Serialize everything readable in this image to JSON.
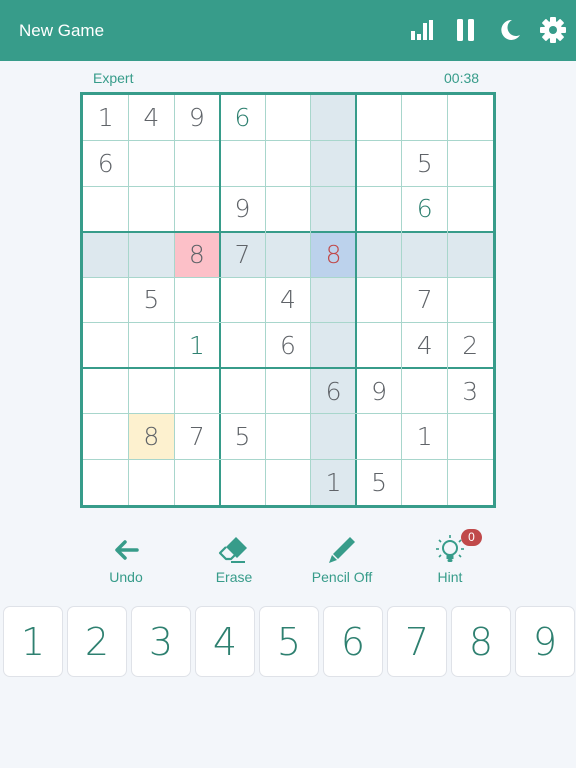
{
  "header": {
    "title": "New Game",
    "icons": [
      "stats-icon",
      "pause-icon",
      "dark-mode-icon",
      "settings-icon"
    ]
  },
  "game": {
    "difficulty": "Expert",
    "timer": "00:38",
    "selected_cell": {
      "row": 3,
      "col": 5
    },
    "grid": [
      [
        1,
        4,
        9,
        6,
        0,
        0,
        0,
        0,
        0
      ],
      [
        6,
        0,
        0,
        0,
        0,
        0,
        0,
        5,
        0
      ],
      [
        0,
        0,
        0,
        9,
        0,
        0,
        0,
        6,
        0
      ],
      [
        0,
        0,
        8,
        7,
        0,
        8,
        0,
        0,
        0
      ],
      [
        0,
        5,
        0,
        0,
        4,
        0,
        0,
        7,
        0
      ],
      [
        0,
        0,
        1,
        0,
        6,
        0,
        0,
        4,
        2
      ],
      [
        0,
        0,
        0,
        0,
        0,
        6,
        9,
        0,
        3
      ],
      [
        0,
        8,
        7,
        5,
        0,
        0,
        0,
        1,
        0
      ],
      [
        0,
        0,
        0,
        0,
        0,
        1,
        5,
        0,
        0
      ]
    ],
    "user_entered": [
      [
        0,
        3
      ],
      [
        2,
        7
      ],
      [
        5,
        2
      ]
    ],
    "error_cells": [
      [
        3,
        5
      ]
    ],
    "conflict_cells": [
      [
        3,
        2
      ]
    ],
    "same_number_cells": [
      [
        7,
        1
      ]
    ]
  },
  "tools": [
    {
      "id": "undo",
      "label": "Undo",
      "icon": "undo-arrow-icon"
    },
    {
      "id": "erase",
      "label": "Erase",
      "icon": "eraser-icon"
    },
    {
      "id": "pencil",
      "label": "Pencil Off",
      "icon": "pencil-icon"
    },
    {
      "id": "hint",
      "label": "Hint",
      "icon": "lightbulb-icon",
      "badge": "0"
    }
  ],
  "numpad": [
    "1",
    "2",
    "3",
    "4",
    "5",
    "6",
    "7",
    "8",
    "9"
  ],
  "colors": {
    "accent": "#379c8a",
    "user_digit": "#2e8070",
    "given_digit": "#5f6368",
    "error_digit": "#c0494a",
    "highlight": "#dde8ee",
    "selected": "#bcd2ec",
    "conflict": "#fcc0c8",
    "same_number": "#fdf1cf",
    "badge": "#c0494a"
  }
}
